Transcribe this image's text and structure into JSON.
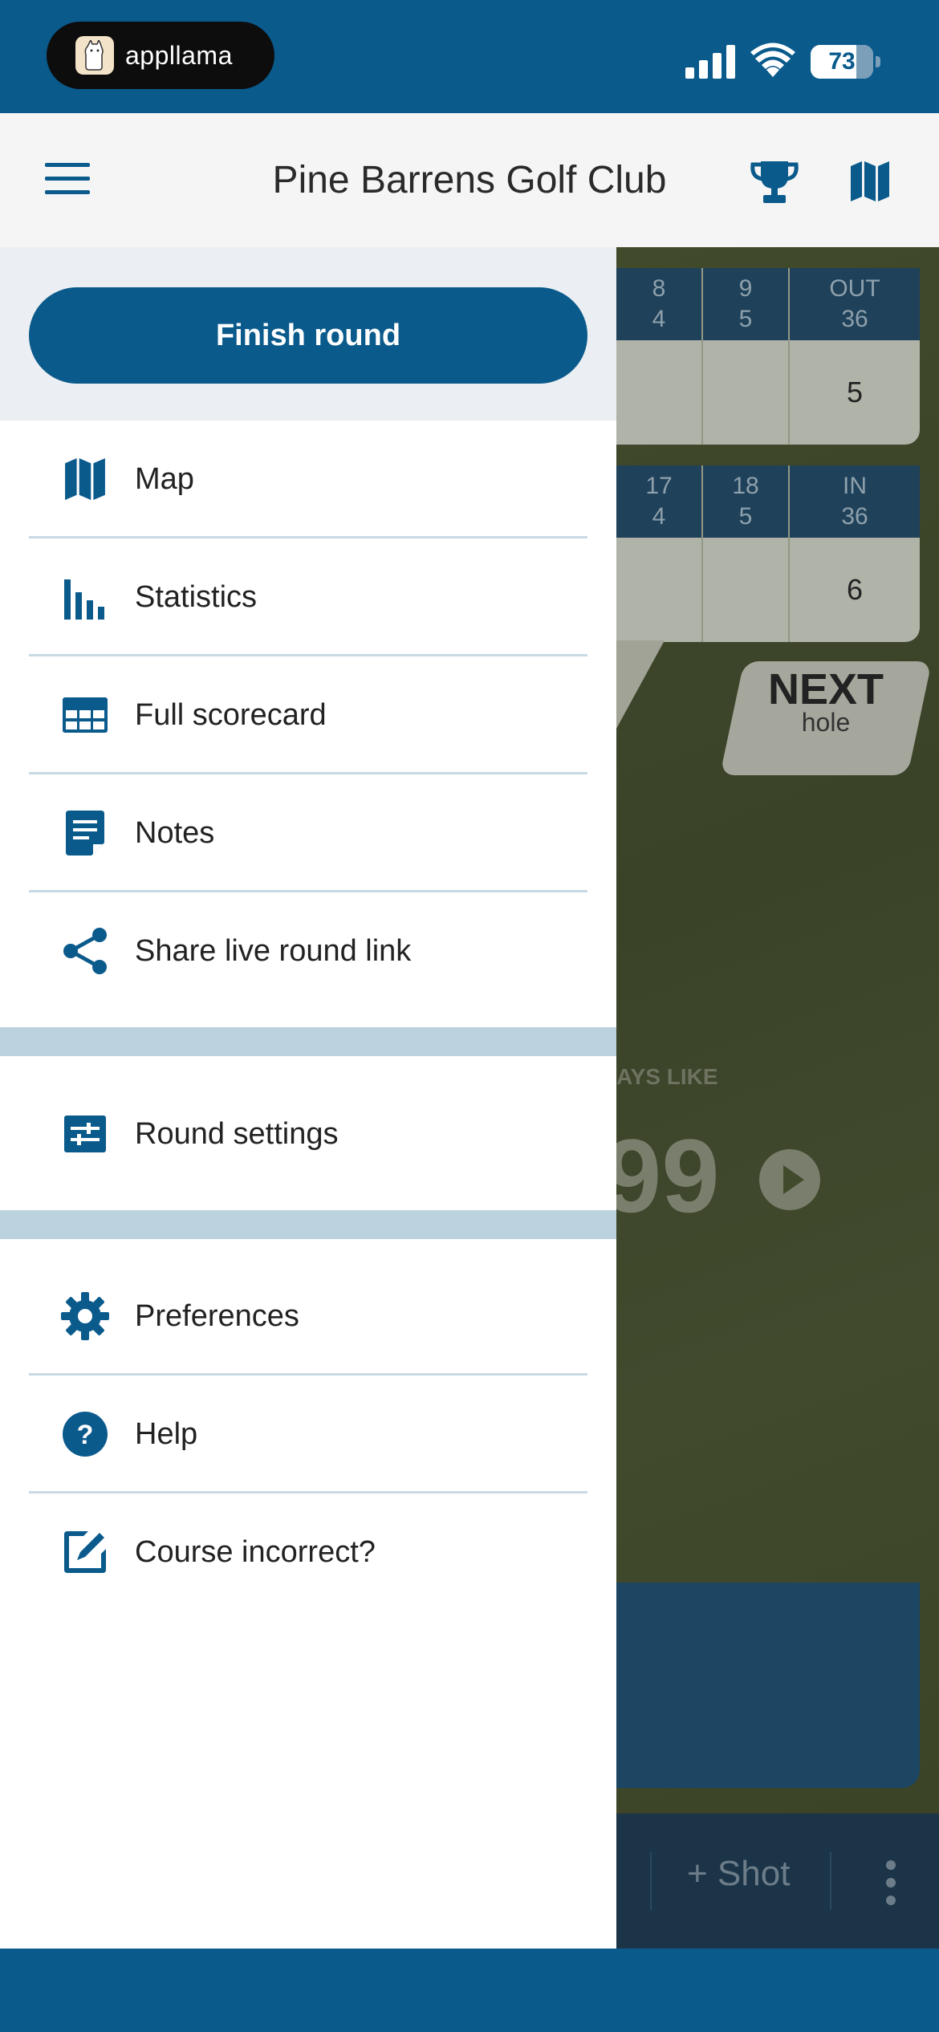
{
  "status_bar": {
    "app_name": "appllama",
    "battery": "73",
    "battery_level": 0.73
  },
  "header": {
    "title": "Pine Barrens Golf Club"
  },
  "drawer": {
    "finish_label": "Finish round",
    "section1": [
      {
        "label": "Map",
        "icon": "map-icon"
      },
      {
        "label": "Statistics",
        "icon": "bar-chart-icon"
      },
      {
        "label": "Full scorecard",
        "icon": "table-icon"
      },
      {
        "label": "Notes",
        "icon": "notes-icon"
      },
      {
        "label": "Share live round link",
        "icon": "share-icon"
      }
    ],
    "section2": [
      {
        "label": "Round settings",
        "icon": "sliders-icon"
      }
    ],
    "section3": [
      {
        "label": "Preferences",
        "icon": "gear-icon"
      },
      {
        "label": "Help",
        "icon": "help-icon"
      },
      {
        "label": "Course incorrect?",
        "icon": "edit-icon"
      }
    ]
  },
  "background": {
    "front_nine": {
      "holes": [
        {
          "hole": "8",
          "par": "4"
        },
        {
          "hole": "9",
          "par": "5"
        }
      ],
      "total_label": "OUT",
      "total_par": "36",
      "total_score": "5"
    },
    "back_nine": {
      "holes": [
        {
          "hole": "17",
          "par": "4"
        },
        {
          "hole": "18",
          "par": "5"
        }
      ],
      "total_label": "IN",
      "total_par": "36",
      "total_score": "6"
    },
    "next_label": "NEXT",
    "next_sub": "hole",
    "plays_like": "AYS LIKE",
    "distance": "99",
    "shot_label": "Shot"
  },
  "colors": {
    "primary": "#0a5a8c",
    "header_bg": "#f5f5f5",
    "divider": "#c8d9e4",
    "band": "#bcd2de"
  }
}
